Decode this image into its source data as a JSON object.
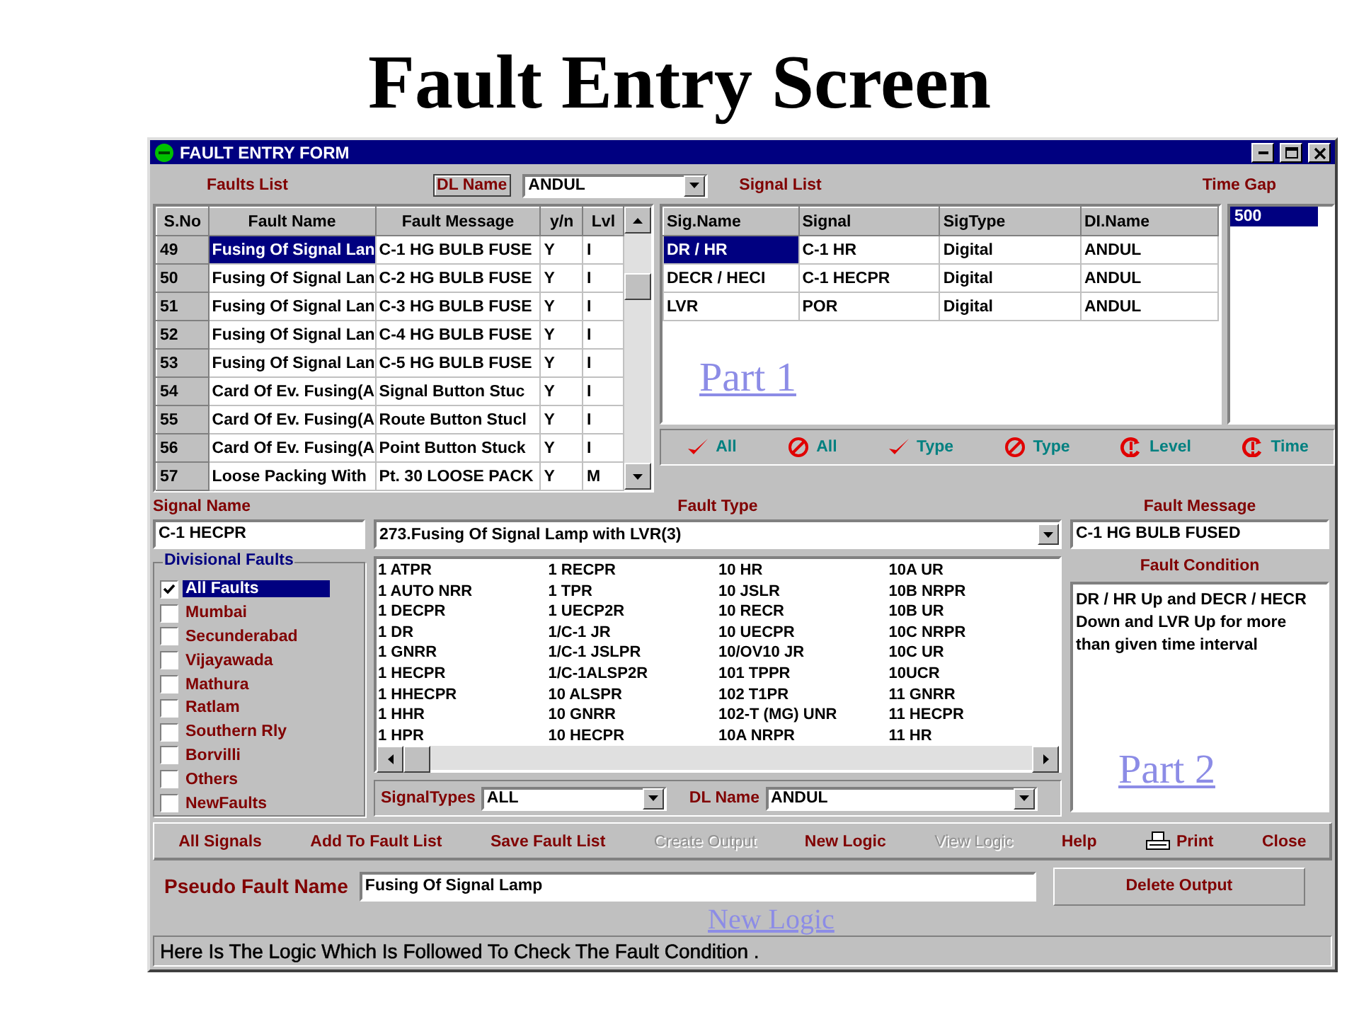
{
  "slide_title": "Fault Entry Screen",
  "window": {
    "title": "FAULT ENTRY FORM"
  },
  "faults_list": {
    "label": "Faults List",
    "dl_name_label": "DL Name",
    "dl_name_value": "ANDUL",
    "columns": [
      "S.No",
      "Fault Name",
      "Fault Message",
      "y/n",
      "Lvl"
    ],
    "rows": [
      {
        "cells": [
          "49",
          "Fusing Of Signal Lan",
          "C-1 HG BULB FUSE",
          "Y",
          "I"
        ],
        "selected": true
      },
      {
        "cells": [
          "50",
          "Fusing Of Signal Lan",
          "C-2 HG BULB FUSE",
          "Y",
          "I"
        ],
        "selected": false
      },
      {
        "cells": [
          "51",
          "Fusing Of Signal Lan",
          "C-3 HG BULB FUSE",
          "Y",
          "I"
        ],
        "selected": false
      },
      {
        "cells": [
          "52",
          "Fusing Of Signal Lan",
          "C-4 HG BULB FUSE",
          "Y",
          "I"
        ],
        "selected": false
      },
      {
        "cells": [
          "53",
          "Fusing Of Signal Lan",
          "C-5 HG BULB FUSE",
          "Y",
          "I"
        ],
        "selected": false
      },
      {
        "cells": [
          "54",
          "Card Of Ev. Fusing(A",
          "Signal Button Stuc",
          "Y",
          "I"
        ],
        "selected": false
      },
      {
        "cells": [
          "55",
          "Card Of Ev. Fusing(A",
          "Route Button Stucl",
          "Y",
          "I"
        ],
        "selected": false
      },
      {
        "cells": [
          "56",
          "Card Of Ev. Fusing(A",
          "Point Button Stuck",
          "Y",
          "I"
        ],
        "selected": false
      },
      {
        "cells": [
          "57",
          "Loose Packing With",
          "Pt. 30 LOOSE PACK",
          "Y",
          "M"
        ],
        "selected": false
      }
    ]
  },
  "signal_list": {
    "label": "Signal List",
    "columns": [
      "Sig.Name",
      "Signal",
      "SigType",
      "DI.Name"
    ],
    "rows": [
      {
        "cells": [
          "DR / HR",
          "C-1 HR",
          "Digital",
          "ANDUL"
        ],
        "selected": true
      },
      {
        "cells": [
          "DECR / HECI",
          "C-1 HECPR",
          "Digital",
          "ANDUL"
        ],
        "selected": false
      },
      {
        "cells": [
          "LVR",
          "POR",
          "Digital",
          "ANDUL"
        ],
        "selected": false
      }
    ],
    "annotation": "Part 1"
  },
  "time_gap": {
    "label": "Time Gap",
    "items": [
      {
        "text": "500",
        "selected": true
      }
    ]
  },
  "filter_buttons": [
    {
      "kind": "check",
      "label": "All"
    },
    {
      "kind": "block",
      "label": "All"
    },
    {
      "kind": "check",
      "label": "Type"
    },
    {
      "kind": "block",
      "label": "Type"
    },
    {
      "kind": "alert",
      "label": "Level"
    },
    {
      "kind": "alert",
      "label": "Time"
    }
  ],
  "signal_name": {
    "label": "Signal Name",
    "value": "C-1 HECPR"
  },
  "fault_type": {
    "label": "Fault Type",
    "value": "273.Fusing Of Signal Lamp with LVR(3)"
  },
  "fault_message": {
    "label": "Fault Message",
    "value": "C-1 HG BULB FUSED"
  },
  "divisional_faults": {
    "label": "Divisional Faults",
    "items": [
      {
        "label": "All Faults",
        "checked": true,
        "selected": true
      },
      {
        "label": "Mumbai",
        "checked": false,
        "selected": false
      },
      {
        "label": "Secunderabad",
        "checked": false,
        "selected": false
      },
      {
        "label": "Vijayawada",
        "checked": false,
        "selected": false
      },
      {
        "label": "Mathura",
        "checked": false,
        "selected": false
      },
      {
        "label": "Ratlam",
        "checked": false,
        "selected": false
      },
      {
        "label": "Southern Rly",
        "checked": false,
        "selected": false
      },
      {
        "label": "Borvilli",
        "checked": false,
        "selected": false
      },
      {
        "label": "Others",
        "checked": false,
        "selected": false
      },
      {
        "label": "NewFaults",
        "checked": false,
        "selected": false
      }
    ]
  },
  "signals_grid": {
    "columns": [
      [
        "1 ATPR",
        "1 AUTO NRR",
        "1 DECPR",
        "1 DR",
        "1 GNRR",
        "1 HECPR",
        "1 HHECPR",
        "1 HHR",
        "1 HPR"
      ],
      [
        "1 RECPR",
        "1 TPR",
        "1 UECP2R",
        "1/C-1 JR",
        "1/C-1 JSLPR",
        "1/C-1ALSP2R",
        "10 ALSPR",
        "10 GNRR",
        "10 HECPR"
      ],
      [
        "10 HR",
        "10 JSLR",
        "10 RECR",
        "10 UECPR",
        "10/OV10 JR",
        "101 TPPR",
        "102 T1PR",
        "102-T (MG) UNR",
        "10A NRPR"
      ],
      [
        "10A UR",
        "10B NRPR",
        "10B UR",
        "10C NRPR",
        "10C UR",
        "10UCR",
        "11 GNRR",
        "11 HECPR",
        "11 HR"
      ]
    ]
  },
  "signal_types": {
    "label": "SignalTypes",
    "value": "ALL"
  },
  "dl_name_filter": {
    "label": "DL Name",
    "value": "ANDUL"
  },
  "fault_condition": {
    "label": "Fault Condition",
    "text": "DR / HR Up and DECR / HECR Down and LVR Up for more than given time interval",
    "annotation": "Part 2"
  },
  "toolbar": {
    "buttons": [
      {
        "kind": "text",
        "label": "All Signals",
        "disabled": false
      },
      {
        "kind": "text",
        "label": "Add To Fault List",
        "disabled": false
      },
      {
        "kind": "text",
        "label": "Save Fault List",
        "disabled": false
      },
      {
        "kind": "text",
        "label": "Create Output",
        "disabled": true
      },
      {
        "kind": "text",
        "label": "New Logic",
        "disabled": false
      },
      {
        "kind": "text",
        "label": "View Logic",
        "disabled": true
      },
      {
        "kind": "text",
        "label": "Help",
        "disabled": false
      },
      {
        "kind": "print",
        "label": "Print",
        "disabled": false
      },
      {
        "kind": "text",
        "label": "Close",
        "disabled": false
      }
    ],
    "annotation": "New Logic"
  },
  "pseudo_fault_name": {
    "label": "Pseudo Fault Name",
    "value": "Fusing Of Signal Lamp"
  },
  "delete_button": "Delete Output",
  "status_bar": "Here Is The Logic Which Is Followed To Check The Fault Condition ."
}
